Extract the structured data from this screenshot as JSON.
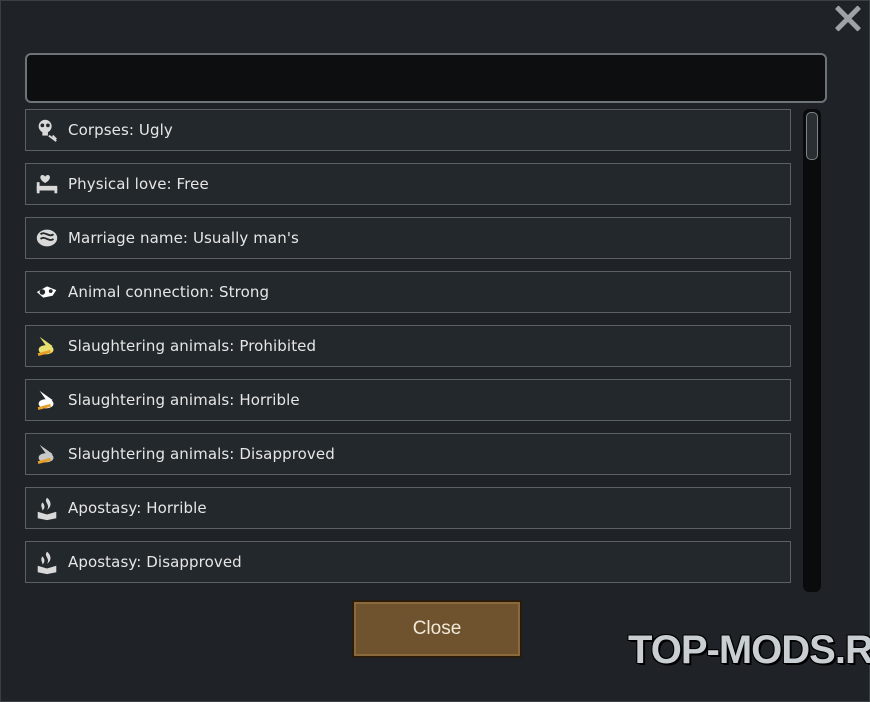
{
  "dialog": {
    "search": {
      "value": "",
      "placeholder": ""
    },
    "close_label": "Close"
  },
  "list": [
    {
      "label": "Corpses: Ugly",
      "icon": "skull-icon",
      "icon_color": "#d9d9d9"
    },
    {
      "label": "Physical love: Free",
      "icon": "bed-heart-icon",
      "icon_color": "#d9d9d9"
    },
    {
      "label": "Marriage name: Usually man's",
      "icon": "couple-scroll-icon",
      "icon_color": "#d9d9d9"
    },
    {
      "label": "Animal connection: Strong",
      "icon": "hand-paw-icon",
      "icon_color": "#ffffff"
    },
    {
      "label": "Slaughtering animals: Prohibited",
      "icon": "knife-animal-icon",
      "icon_color": "#e8e070"
    },
    {
      "label": "Slaughtering animals: Horrible",
      "icon": "knife-animal-icon",
      "icon_color": "#ffffff"
    },
    {
      "label": "Slaughtering animals: Disapproved",
      "icon": "knife-animal-icon",
      "icon_color": "#c8c8c8"
    },
    {
      "label": "Apostasy: Horrible",
      "icon": "burning-book-icon",
      "icon_color": "#d9d9d9"
    },
    {
      "label": "Apostasy: Disapproved",
      "icon": "burning-book-icon",
      "icon_color": "#d9d9d9"
    },
    {
      "label": "",
      "icon": "generic-icon",
      "icon_color": "#d9d9d9"
    }
  ],
  "watermark": "TOP-MODS.RU"
}
